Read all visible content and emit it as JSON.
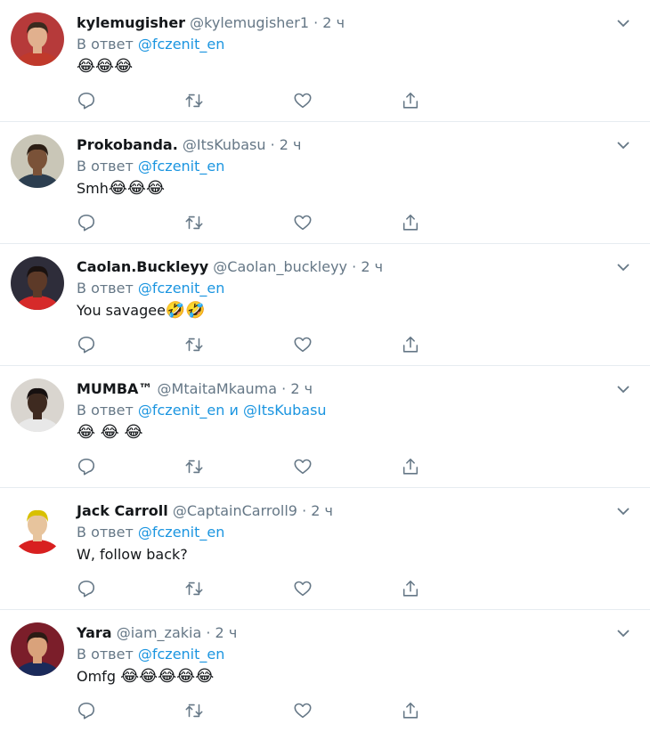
{
  "reply_prefix": "В ответ",
  "and_word": "и",
  "tweets": [
    {
      "name": "kylemugisher",
      "handle": "@kylemugisher1",
      "time": "2 ч",
      "mentions": [
        "@fczenit_en"
      ],
      "text": "",
      "emoji": "😂😂😂",
      "avatar": {
        "bg": "#b63a3a",
        "skin": "#e1b08e",
        "hair": "#3a2a1e",
        "shirt": "#c0392b"
      }
    },
    {
      "name": "Prokobanda.",
      "handle": "@ItsKubasu",
      "time": "2 ч",
      "mentions": [
        "@fczenit_en"
      ],
      "text": "Smh",
      "emoji": "😂😂😂",
      "avatar": {
        "bg": "#c9c6b7",
        "skin": "#7a5238",
        "hair": "#2b1d14",
        "shirt": "#2c3e50"
      }
    },
    {
      "name": "Caolan.Buckleyy",
      "handle": "@Caolan_buckleyy",
      "time": "2 ч",
      "mentions": [
        "@fczenit_en"
      ],
      "text": "You savagee",
      "emoji": "🤣🤣",
      "avatar": {
        "bg": "#2e2d3a",
        "skin": "#5d3a28",
        "hair": "#1a1210",
        "shirt": "#d62a2a"
      }
    },
    {
      "name": "MUMBA™",
      "handle": "@MtaitaMkauma",
      "time": "2 ч",
      "mentions": [
        "@fczenit_en",
        "@ItsKubasu"
      ],
      "text": "",
      "emoji": "😂 😂 😂",
      "avatar": {
        "bg": "#d9d5cf",
        "skin": "#3e2a20",
        "hair": "#161010",
        "shirt": "#e8e8e8"
      }
    },
    {
      "name": "Jack Carroll",
      "handle": "@CaptainCarroll9",
      "time": "2 ч",
      "mentions": [
        "@fczenit_en"
      ],
      "text": "W, follow back?",
      "emoji": "",
      "avatar": {
        "bg": "#ffffff",
        "skin": "#e7c49d",
        "hair": "#d8c000",
        "shirt": "#d82020"
      }
    },
    {
      "name": "Yara",
      "handle": "@iam_zakia",
      "time": "2 ч",
      "mentions": [
        "@fczenit_en"
      ],
      "text": "Omfg ",
      "emoji": "😂😂😂😂😂",
      "avatar": {
        "bg": "#7b1e2a",
        "skin": "#d9a27b",
        "hair": "#2b1b14",
        "shirt": "#1a2a5a"
      }
    }
  ],
  "colors": {
    "link": "#1b95e0",
    "muted": "#657786",
    "icon": "#657786",
    "border": "#e6ecf0"
  },
  "icons": [
    "reply-icon",
    "retweet-icon",
    "like-icon",
    "share-icon",
    "chevron-down-icon"
  ]
}
